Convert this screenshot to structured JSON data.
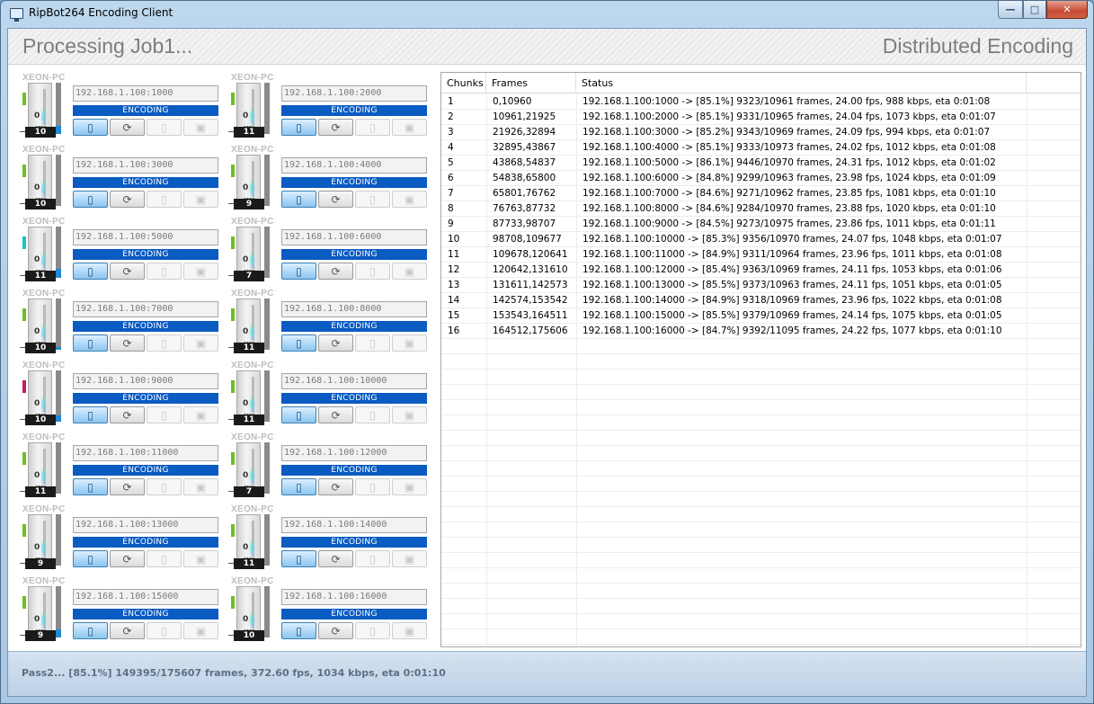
{
  "window": {
    "title": "RipBot264 Encoding Client",
    "min": "—",
    "max": "□",
    "close": "✕"
  },
  "header": {
    "left": "Processing Job1...",
    "right": "Distributed Encoding"
  },
  "nodes": [
    {
      "host": "XEON-PC",
      "ip": "192.168.1.100:1000",
      "status": "ENCODING",
      "cpu": "10",
      "led": "#6cc11f",
      "meter": 0.15
    },
    {
      "host": "XEON-PC",
      "ip": "192.168.1.100:2000",
      "status": "ENCODING",
      "cpu": "11",
      "led": "#6cc11f",
      "meter": 0.0
    },
    {
      "host": "XEON-PC",
      "ip": "192.168.1.100:3000",
      "status": "ENCODING",
      "cpu": "10",
      "led": "#6cc11f",
      "meter": 0.0
    },
    {
      "host": "XEON-PC",
      "ip": "192.168.1.100:4000",
      "status": "ENCODING",
      "cpu": "9",
      "led": "#6cc11f",
      "meter": 0.0
    },
    {
      "host": "XEON-PC",
      "ip": "192.168.1.100:5000",
      "status": "ENCODING",
      "cpu": "11",
      "led": "#19c3c8",
      "meter": 0.18
    },
    {
      "host": "XEON-PC",
      "ip": "192.168.1.100:6000",
      "status": "ENCODING",
      "cpu": "7",
      "led": "#6cc11f",
      "meter": 0.0
    },
    {
      "host": "XEON-PC",
      "ip": "192.168.1.100:7000",
      "status": "ENCODING",
      "cpu": "10",
      "led": "#6cc11f",
      "meter": 0.05
    },
    {
      "host": "XEON-PC",
      "ip": "192.168.1.100:8000",
      "status": "ENCODING",
      "cpu": "11",
      "led": "#6cc11f",
      "meter": 0.0
    },
    {
      "host": "XEON-PC",
      "ip": "192.168.1.100:9000",
      "status": "ENCODING",
      "cpu": "10",
      "led": "#c7195f",
      "meter": 0.12
    },
    {
      "host": "XEON-PC",
      "ip": "192.168.1.100:10000",
      "status": "ENCODING",
      "cpu": "11",
      "led": "#6cc11f",
      "meter": 0.0
    },
    {
      "host": "XEON-PC",
      "ip": "192.168.1.100:11000",
      "status": "ENCODING",
      "cpu": "11",
      "led": "#6cc11f",
      "meter": 0.0
    },
    {
      "host": "XEON-PC",
      "ip": "192.168.1.100:12000",
      "status": "ENCODING",
      "cpu": "7",
      "led": "#6cc11f",
      "meter": 0.0
    },
    {
      "host": "XEON-PC",
      "ip": "192.168.1.100:13000",
      "status": "ENCODING",
      "cpu": "9",
      "led": "#6cc11f",
      "meter": 0.0
    },
    {
      "host": "XEON-PC",
      "ip": "192.168.1.100:14000",
      "status": "ENCODING",
      "cpu": "11",
      "led": "#6cc11f",
      "meter": 0.0
    },
    {
      "host": "XEON-PC",
      "ip": "192.168.1.100:15000",
      "status": "ENCODING",
      "cpu": "9",
      "led": "#6cc11f",
      "meter": 0.15
    },
    {
      "host": "XEON-PC",
      "ip": "192.168.1.100:16000",
      "status": "ENCODING",
      "cpu": "10",
      "led": "#6cc11f",
      "meter": 0.0
    }
  ],
  "table": {
    "columns": [
      "Chunks",
      "Frames",
      "Status"
    ],
    "rows": [
      [
        "1",
        "0,10960",
        "192.168.1.100:1000 -> [85.1%] 9323/10961 frames, 24.00 fps, 988 kbps, eta 0:01:08"
      ],
      [
        "2",
        "10961,21925",
        "192.168.1.100:2000 -> [85.1%] 9331/10965 frames, 24.04 fps, 1073 kbps, eta 0:01:07"
      ],
      [
        "3",
        "21926,32894",
        "192.168.1.100:3000 -> [85.2%] 9343/10969 frames, 24.09 fps, 994 kbps, eta 0:01:07"
      ],
      [
        "4",
        "32895,43867",
        "192.168.1.100:4000 -> [85.1%] 9333/10973 frames, 24.02 fps, 1012 kbps, eta 0:01:08"
      ],
      [
        "5",
        "43868,54837",
        "192.168.1.100:5000 -> [86.1%] 9446/10970 frames, 24.31 fps, 1012 kbps, eta 0:01:02"
      ],
      [
        "6",
        "54838,65800",
        "192.168.1.100:6000 -> [84.8%] 9299/10963 frames, 23.98 fps, 1024 kbps, eta 0:01:09"
      ],
      [
        "7",
        "65801,76762",
        "192.168.1.100:7000 -> [84.6%] 9271/10962 frames, 23.85 fps, 1081 kbps, eta 0:01:10"
      ],
      [
        "8",
        "76763,87732",
        "192.168.1.100:8000 -> [84.6%] 9284/10970 frames, 23.88 fps, 1020 kbps, eta 0:01:10"
      ],
      [
        "9",
        "87733,98707",
        "192.168.1.100:9000 -> [84.5%] 9273/10975 frames, 23.86 fps, 1011 kbps, eta 0:01:11"
      ],
      [
        "10",
        "98708,109677",
        "192.168.1.100:10000 -> [85.3%] 9356/10970 frames, 24.07 fps, 1048 kbps, eta 0:01:07"
      ],
      [
        "11",
        "109678,120641",
        "192.168.1.100:11000 -> [84.9%] 9311/10964 frames, 23.96 fps, 1011 kbps, eta 0:01:08"
      ],
      [
        "12",
        "120642,131610",
        "192.168.1.100:12000 -> [85.4%] 9363/10969 frames, 24.11 fps, 1053 kbps, eta 0:01:06"
      ],
      [
        "13",
        "131611,142573",
        "192.168.1.100:13000 -> [85.5%] 9373/10963 frames, 24.11 fps, 1051 kbps, eta 0:01:05"
      ],
      [
        "14",
        "142574,153542",
        "192.168.1.100:14000 -> [84.9%] 9318/10969 frames, 23.96 fps, 1022 kbps, eta 0:01:08"
      ],
      [
        "15",
        "153543,164511",
        "192.168.1.100:15000 -> [85.5%] 9379/10969 frames, 24.14 fps, 1075 kbps, eta 0:01:05"
      ],
      [
        "16",
        "164512,175606",
        "192.168.1.100:16000 -> [84.7%] 9392/11095 frames, 24.22 fps, 1077 kbps, eta 0:01:10"
      ]
    ]
  },
  "footer": {
    "message": "Pass2... [85.1%] 149395/175607 frames, 372.60 fps, 1034 kbps, eta 0:01:10"
  },
  "icons": {
    "node_buttons": [
      "remote-icon",
      "refresh-icon",
      "pause-icon",
      "stop-icon"
    ],
    "glyphs": [
      "▯",
      "⟳",
      "▯",
      "▣"
    ]
  }
}
